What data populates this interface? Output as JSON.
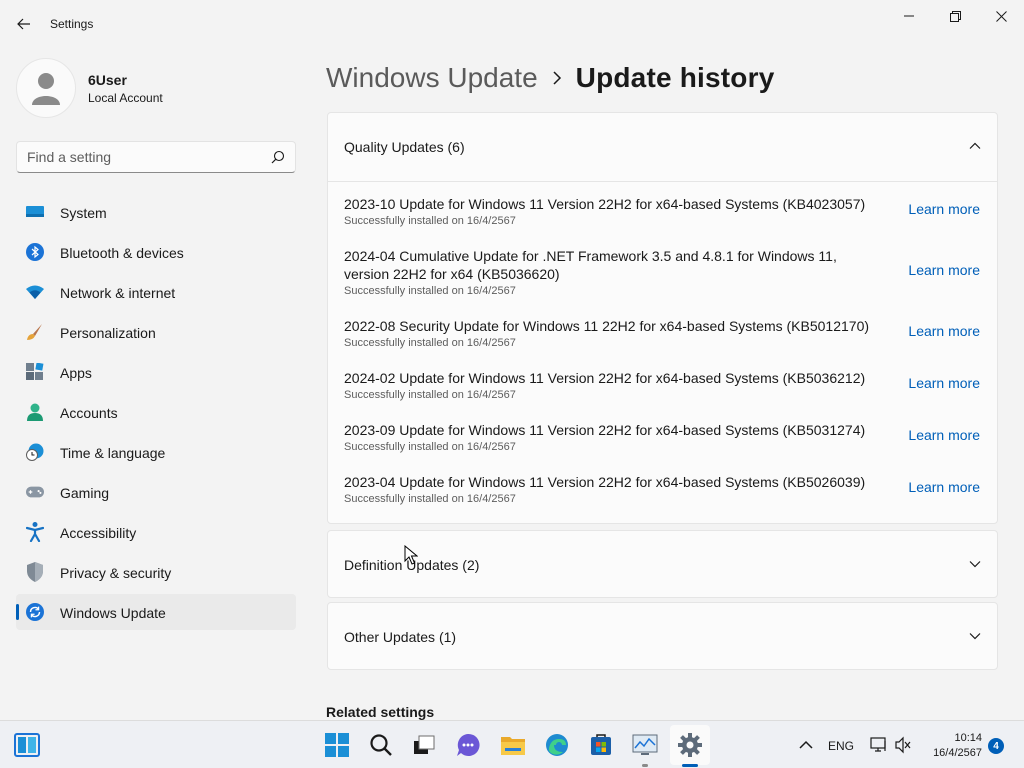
{
  "app": {
    "title": "Settings"
  },
  "user": {
    "name": "6User",
    "account_type": "Local Account"
  },
  "search": {
    "placeholder": "Find a setting"
  },
  "sidebar": {
    "items": [
      {
        "label": "System",
        "icon": "system-icon"
      },
      {
        "label": "Bluetooth & devices",
        "icon": "bluetooth-icon"
      },
      {
        "label": "Network & internet",
        "icon": "wifi-icon"
      },
      {
        "label": "Personalization",
        "icon": "brush-icon"
      },
      {
        "label": "Apps",
        "icon": "apps-icon"
      },
      {
        "label": "Accounts",
        "icon": "accounts-icon"
      },
      {
        "label": "Time & language",
        "icon": "clock-globe-icon"
      },
      {
        "label": "Gaming",
        "icon": "gamepad-icon"
      },
      {
        "label": "Accessibility",
        "icon": "accessibility-icon"
      },
      {
        "label": "Privacy & security",
        "icon": "shield-icon"
      },
      {
        "label": "Windows Update",
        "icon": "windows-update-icon",
        "active": true
      }
    ]
  },
  "breadcrumb": {
    "parent": "Windows Update",
    "current": "Update history"
  },
  "quality_updates": {
    "title": "Quality Updates (6)",
    "items": [
      {
        "name": "2023-10 Update for Windows 11 Version 22H2 for x64-based Systems (KB4023057)",
        "status": "Successfully installed on 16/4/2567",
        "link": "Learn more"
      },
      {
        "name": "2024-04 Cumulative Update for .NET Framework 3.5 and 4.8.1 for Windows 11, version 22H2 for x64 (KB5036620)",
        "status": "Successfully installed on 16/4/2567",
        "link": "Learn more"
      },
      {
        "name": "2022-08 Security Update for Windows 11 22H2 for x64-based Systems (KB5012170)",
        "status": "Successfully installed on 16/4/2567",
        "link": "Learn more"
      },
      {
        "name": "2024-02 Update for Windows 11 Version 22H2 for x64-based Systems (KB5036212)",
        "status": "Successfully installed on 16/4/2567",
        "link": "Learn more"
      },
      {
        "name": "2023-09 Update for Windows 11 Version 22H2 for x64-based Systems (KB5031274)",
        "status": "Successfully installed on 16/4/2567",
        "link": "Learn more"
      },
      {
        "name": "2023-04 Update for Windows 11 Version 22H2 for x64-based Systems (KB5026039)",
        "status": "Successfully installed on 16/4/2567",
        "link": "Learn more"
      }
    ]
  },
  "definition_updates": {
    "title": "Definition Updates (2)"
  },
  "other_updates": {
    "title": "Other Updates (1)"
  },
  "related": {
    "title": "Related settings"
  },
  "taskbar": {
    "language": "ENG",
    "time": "10:14",
    "date": "16/4/2567",
    "notification_count": "4"
  },
  "colors": {
    "accent": "#005fb8",
    "background": "#f3f3f3",
    "card": "#fbfbfb"
  }
}
